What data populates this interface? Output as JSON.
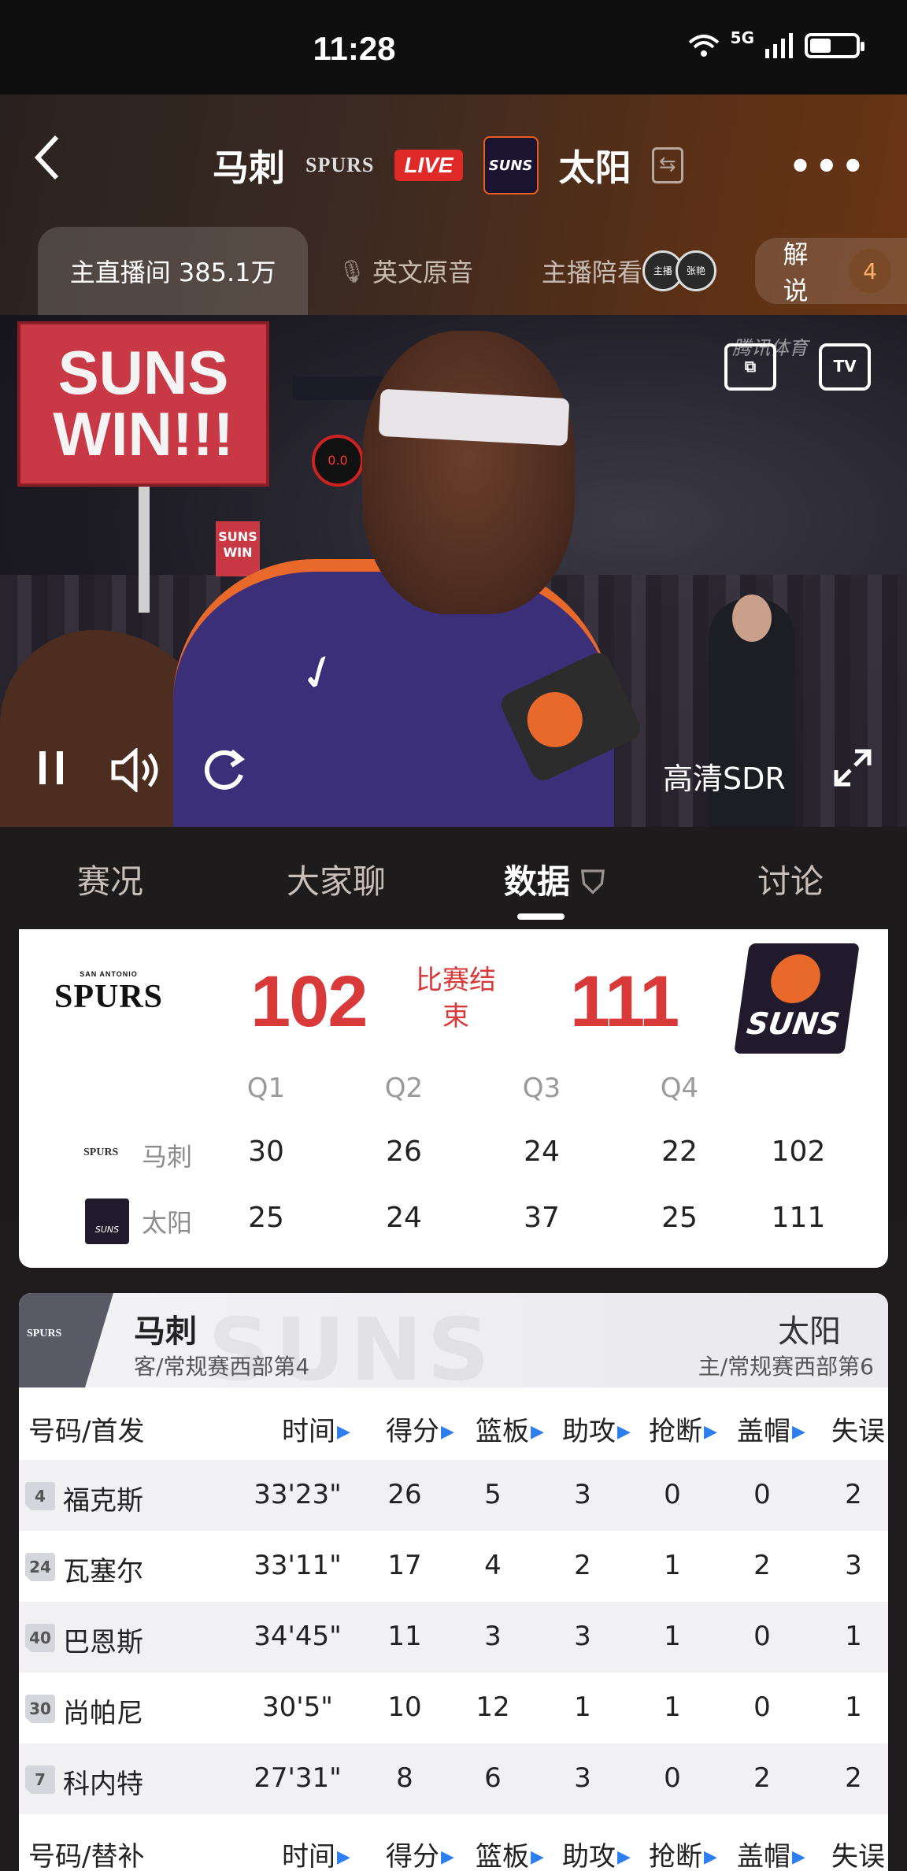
{
  "status_bar": {
    "time": "11:28",
    "network": "5G"
  },
  "header": {
    "away_team": "马刺",
    "home_team": "太阳",
    "away_logo_text": "SPURS",
    "home_logo_text": "SUNS",
    "live_label": "LIVE",
    "more": "•••"
  },
  "channels": {
    "main": "主直播间 385.1万",
    "english": "英文原音",
    "host": "主播陪看",
    "commentary": "解说",
    "commentary_count": "4"
  },
  "video": {
    "sign_text": "SUNS WIN!!!",
    "small_sign": "SUNS WIN",
    "watermark": "腾讯体育",
    "quality": "高清SDR",
    "clock": "0.0",
    "host_avatar_1": "主播",
    "host_avatar_2": "张艳"
  },
  "content_tabs": [
    "赛况",
    "大家聊",
    "数据",
    "讨论"
  ],
  "scoreboard": {
    "away_score": "102",
    "home_score": "111",
    "status": "比赛结束",
    "away_logo_top": "SAN ANTONIO",
    "away_logo_main": "SPURS",
    "home_logo_main": "SUNS",
    "quarters": [
      "Q1",
      "Q2",
      "Q3",
      "Q4"
    ],
    "rows": [
      {
        "team": "马刺",
        "logo": "SPURS",
        "q": [
          "30",
          "26",
          "24",
          "22"
        ],
        "total": "102"
      },
      {
        "team": "太阳",
        "logo": "SUNS",
        "q": [
          "25",
          "24",
          "37",
          "25"
        ],
        "total": "111"
      }
    ]
  },
  "player_stats": {
    "away_name": "马刺",
    "away_sub": "客/常规赛西部第4",
    "home_name": "太阳",
    "home_sub": "主/常规赛西部第6",
    "bg_word": "SUNS",
    "headers_starters": [
      "号码/首发",
      "时间",
      "得分",
      "篮板",
      "助攻",
      "抢断",
      "盖帽",
      "失误"
    ],
    "headers_bench": [
      "号码/替补",
      "时间",
      "得分",
      "篮板",
      "助攻",
      "抢断",
      "盖帽",
      "失误"
    ],
    "starters": [
      {
        "num": "4",
        "name": "福克斯",
        "time": "33'23\"",
        "pts": "26",
        "reb": "5",
        "ast": "3",
        "stl": "0",
        "blk": "0",
        "to": "2"
      },
      {
        "num": "24",
        "name": "瓦塞尔",
        "time": "33'11\"",
        "pts": "17",
        "reb": "4",
        "ast": "2",
        "stl": "1",
        "blk": "2",
        "to": "3"
      },
      {
        "num": "40",
        "name": "巴恩斯",
        "time": "34'45\"",
        "pts": "11",
        "reb": "3",
        "ast": "3",
        "stl": "1",
        "blk": "0",
        "to": "1"
      },
      {
        "num": "30",
        "name": "尚帕尼",
        "time": "30'5\"",
        "pts": "10",
        "reb": "12",
        "ast": "1",
        "stl": "1",
        "blk": "0",
        "to": "1"
      },
      {
        "num": "7",
        "name": "科内特",
        "time": "27'31\"",
        "pts": "8",
        "reb": "6",
        "ast": "3",
        "stl": "0",
        "blk": "2",
        "to": "2"
      }
    ]
  },
  "colors": {
    "accent_red": "#d83a3a",
    "sort_blue": "#2d7ff0",
    "live_red": "#e02a2a"
  }
}
